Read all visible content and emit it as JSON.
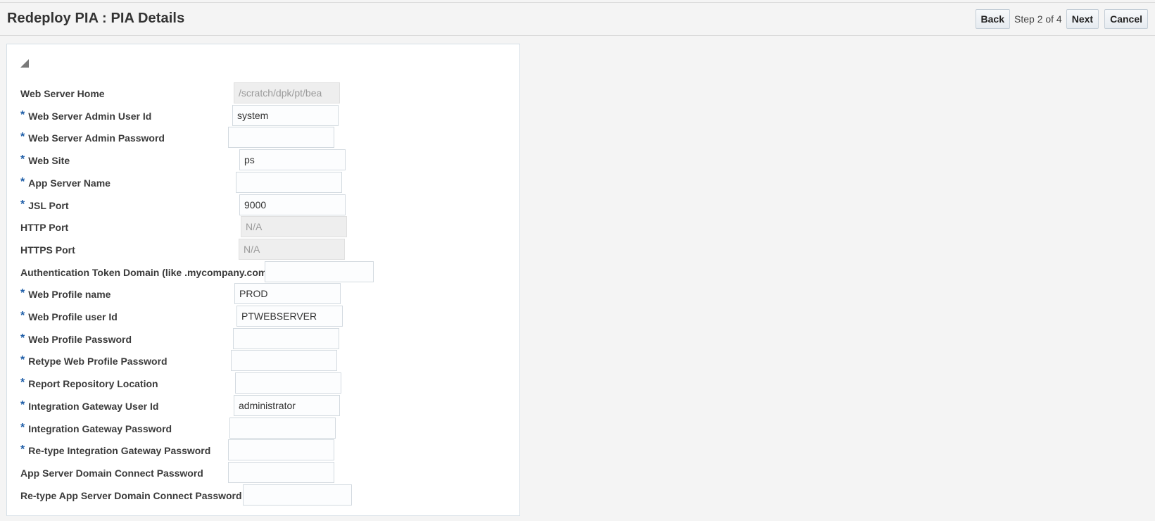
{
  "header": {
    "title": "Redeploy PIA : PIA Details",
    "back_label": "Back",
    "step_text": "Step 2 of 4",
    "next_label": "Next",
    "cancel_label": "Cancel"
  },
  "form": {
    "fields": [
      {
        "label": "Web Server Home",
        "required": false,
        "value": "/scratch/dpk/pt/bea",
        "readonly": true
      },
      {
        "label": "Web Server Admin User Id",
        "required": true,
        "value": "system",
        "readonly": false
      },
      {
        "label": "Web Server Admin Password",
        "required": true,
        "value": "",
        "readonly": false
      },
      {
        "label": "Web Site",
        "required": true,
        "value": "ps",
        "readonly": false
      },
      {
        "label": "App Server Name",
        "required": true,
        "value": "",
        "readonly": false
      },
      {
        "label": "JSL Port",
        "required": true,
        "value": "9000",
        "readonly": false
      },
      {
        "label": "HTTP Port",
        "required": false,
        "value": "N/A",
        "readonly": true
      },
      {
        "label": "HTTPS Port",
        "required": false,
        "value": "N/A",
        "readonly": true
      },
      {
        "label": "Authentication Token Domain (like .mycompany.com)",
        "required": false,
        "value": "",
        "readonly": false
      },
      {
        "label": "Web Profile name",
        "required": true,
        "value": "PROD",
        "readonly": false
      },
      {
        "label": "Web Profile user Id",
        "required": true,
        "value": "PTWEBSERVER",
        "readonly": false
      },
      {
        "label": "Web Profile Password",
        "required": true,
        "value": "",
        "readonly": false
      },
      {
        "label": "Retype Web Profile Password",
        "required": true,
        "value": "",
        "readonly": false
      },
      {
        "label": "Report Repository Location",
        "required": true,
        "value": "",
        "readonly": false
      },
      {
        "label": "Integration Gateway User Id",
        "required": true,
        "value": "administrator",
        "readonly": false
      },
      {
        "label": "Integration Gateway Password",
        "required": true,
        "value": "",
        "readonly": false
      },
      {
        "label": "Re-type Integration Gateway Password",
        "required": true,
        "value": "",
        "readonly": false
      },
      {
        "label": "App Server Domain Connect Password",
        "required": false,
        "value": "",
        "readonly": false
      },
      {
        "label": "Re-type App Server Domain Connect Password",
        "required": false,
        "value": "",
        "readonly": false
      }
    ]
  }
}
